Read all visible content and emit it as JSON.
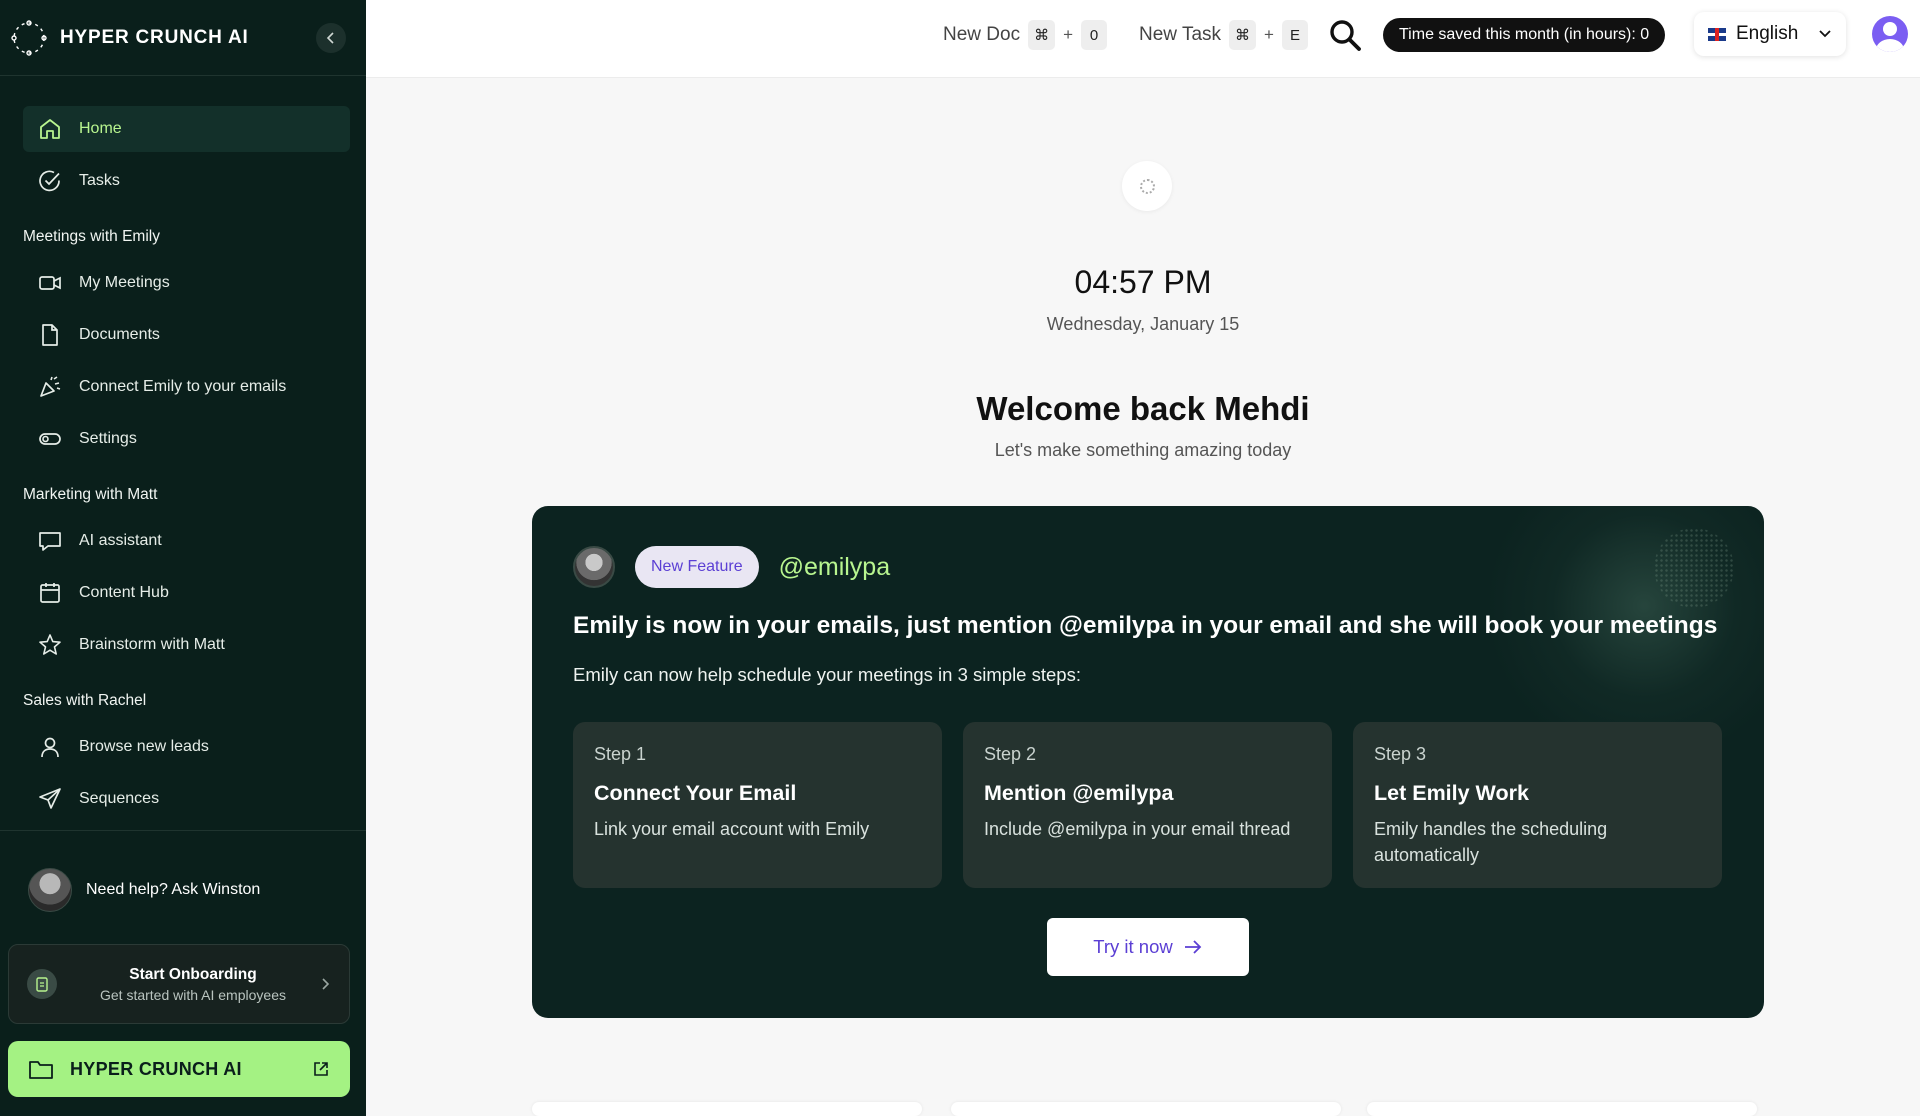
{
  "sidebar": {
    "brand": "HYPER CRUNCH AI",
    "items": {
      "home": "Home",
      "tasks": "Tasks",
      "my_meetings": "My Meetings",
      "documents": "Documents",
      "connect_emails": "Connect Emily to your emails",
      "settings": "Settings",
      "ai_assistant": "AI assistant",
      "content_hub": "Content Hub",
      "brainstorm": "Brainstorm with Matt",
      "browse_leads": "Browse new leads",
      "sequences": "Sequences"
    },
    "sections": {
      "meetings": "Meetings with Emily",
      "marketing": "Marketing with Matt",
      "sales": "Sales with Rachel"
    },
    "help": "Need help? Ask Winston",
    "onboarding": {
      "title": "Start Onboarding",
      "subtitle": "Get started with AI employees"
    },
    "brand_button": "HYPER CRUNCH AI"
  },
  "topbar": {
    "new_doc": "New Doc",
    "new_doc_key1": "⌘",
    "new_doc_key2": "0",
    "new_task": "New Task",
    "new_task_key1": "⌘",
    "new_task_key2": "E",
    "plus": "+",
    "time_saved": "Time saved this month (in hours): 0",
    "language": "English"
  },
  "main": {
    "time": "04:57 PM",
    "date": "Wednesday, January 15",
    "welcome": "Welcome back Mehdi",
    "welcome_sub": "Let's make something amazing today",
    "feature": {
      "badge": "New Feature",
      "handle": "@emilypa",
      "title": "Emily is now in your emails, just mention @emilypa in your email and she will book your meetings",
      "subtitle": "Emily can now help schedule your meetings in 3 simple steps:",
      "steps": [
        {
          "num": "Step 1",
          "title": "Connect Your Email",
          "desc": "Link your email account with Emily"
        },
        {
          "num": "Step 2",
          "title": "Mention @emilypa",
          "desc": "Include @emilypa in your email thread"
        },
        {
          "num": "Step 3",
          "title": "Let Emily Work",
          "desc": "Emily handles the scheduling automatically"
        }
      ],
      "cta": "Try it now"
    }
  },
  "icons": {
    "accent": "#b8f58f",
    "purple": "#5b3fd4",
    "sidebar_bg": "#0a1f1b"
  }
}
